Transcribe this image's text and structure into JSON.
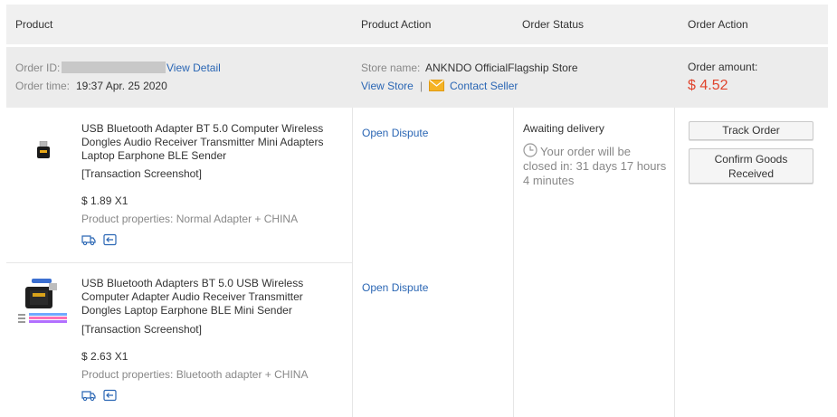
{
  "header": {
    "product": "Product",
    "product_action": "Product Action",
    "order_status": "Order Status",
    "order_action": "Order Action"
  },
  "order": {
    "id_label": "Order ID:",
    "view_detail": "View Detail",
    "time_label": "Order time:",
    "time_value": "19:37 Apr. 25 2020",
    "store_label": "Store name:",
    "store_name": "ANKNDO OfficialFlagship Store",
    "view_store": "View Store",
    "separator": "|",
    "contact_seller": "Contact Seller",
    "amount_label": "Order amount:",
    "amount_value": "$ 4.52",
    "amount_color": "#e0442d"
  },
  "items": [
    {
      "name_lines": [
        "USB Bluetooth Adapter BT 5.0 Computer Wireless",
        "Dongles Audio Receiver Transmitter Mini Adapters",
        "Laptop Earphone BLE Sender"
      ],
      "screenshot": "[Transaction Screenshot]",
      "price": "$ 1.89 X1",
      "properties": "Product properties: Normal Adapter + CHINA",
      "action": "Open Dispute"
    },
    {
      "name_lines": [
        "USB Bluetooth Adapters BT 5.0 USB Wireless",
        "Computer Adapter Audio Receiver Transmitter",
        "Dongles Laptop Earphone BLE Mini Sender"
      ],
      "screenshot": "[Transaction Screenshot]",
      "price": "$ 2.63 X1",
      "properties": "Product properties: Bluetooth adapter + CHINA",
      "action": "Open Dispute"
    }
  ],
  "status": {
    "title": "Awaiting delivery",
    "countdown_lines": [
      "Your order will be",
      "closed in: 31 days 17 hours",
      "4 minutes"
    ]
  },
  "actions": {
    "track_order": "Track Order",
    "confirm_line1": "Confirm Goods",
    "confirm_line2": "Received"
  },
  "icons": {
    "shipping": "truck-icon",
    "return": "return-icon",
    "mail": "envelope-icon",
    "clock": "clock-icon",
    "link_color": "#2a66b4"
  }
}
